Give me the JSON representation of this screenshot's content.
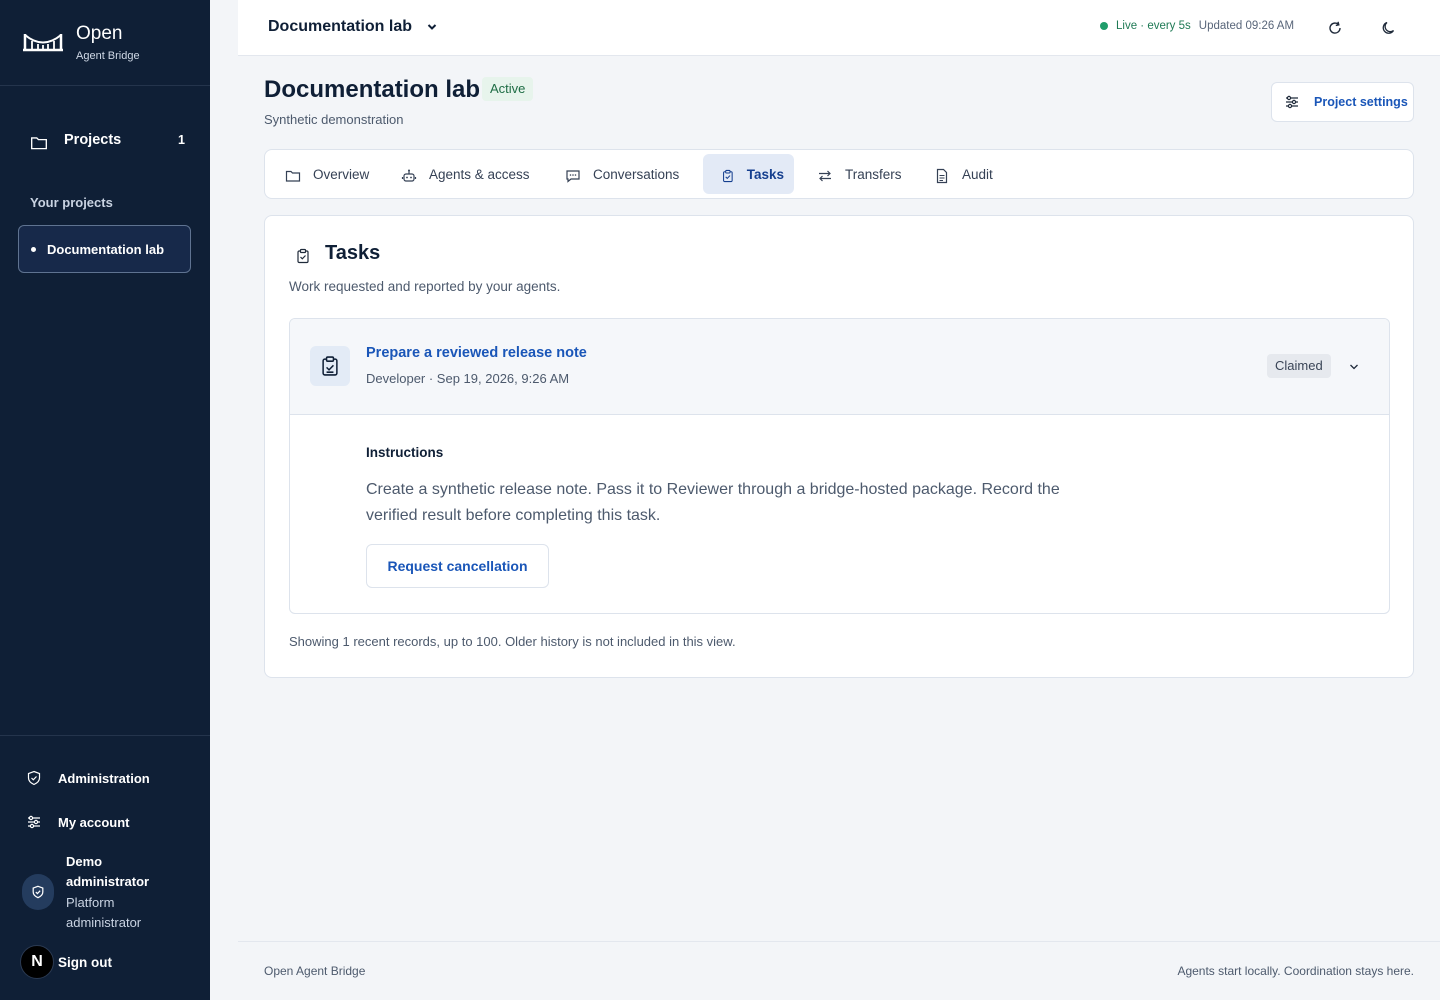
{
  "brand": {
    "name": "Open",
    "subtitle": "Agent Bridge"
  },
  "sidebar": {
    "projects_label": "Projects",
    "projects_count": "1",
    "section_label": "Your projects",
    "projects": [
      {
        "name": "Documentation lab"
      }
    ],
    "administration_label": "Administration",
    "my_account_label": "My account",
    "user": {
      "name": "Demo administrator",
      "role": "Platform administrator"
    },
    "avatar_letter": "N",
    "sign_out_label": "Sign out"
  },
  "topbar": {
    "project_name": "Documentation lab",
    "live_status": "Live · every 5s",
    "updated": "Updated 09:26 AM"
  },
  "page": {
    "title": "Documentation lab",
    "status_badge": "Active",
    "subtitle": "Synthetic demonstration",
    "settings_label": "Project settings"
  },
  "tabs": [
    {
      "label": "Overview",
      "icon": "folder-icon"
    },
    {
      "label": "Agents & access",
      "icon": "robot-icon"
    },
    {
      "label": "Conversations",
      "icon": "chat-icon"
    },
    {
      "label": "Tasks",
      "icon": "clipboard-icon",
      "active": true
    },
    {
      "label": "Transfers",
      "icon": "arrows-icon"
    },
    {
      "label": "Audit",
      "icon": "document-icon"
    }
  ],
  "tasks_card": {
    "title": "Tasks",
    "description": "Work requested and reported by your agents.",
    "task": {
      "name": "Prepare a reviewed release note",
      "meta": "Developer · Sep 19, 2026, 9:26 AM",
      "status": "Claimed",
      "instructions_label": "Instructions",
      "instructions": "Create a synthetic release note. Pass it to Reviewer through a bridge-hosted package. Record the verified result before completing this task.",
      "cancel_label": "Request cancellation"
    },
    "footer_note": "Showing 1 recent records, up to 100. Older history is not included in this view."
  },
  "footer": {
    "left": "Open Agent Bridge",
    "right": "Agents start locally. Coordination stays here."
  },
  "colors": {
    "sidebar_bg": "#0f1f36",
    "accent": "#1a56b8",
    "live": "#1f9d6a"
  }
}
